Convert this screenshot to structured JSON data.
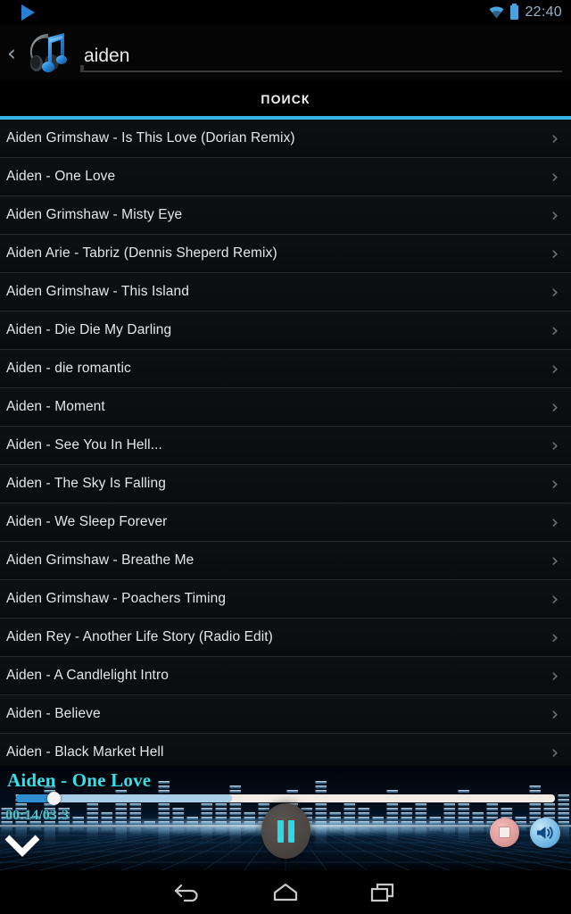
{
  "statusbar": {
    "notification_icon": "play-triangle-icon",
    "wifi_icon": "wifi-icon",
    "battery_icon": "battery-icon",
    "clock": "22:40",
    "clock_color": "#93b4c9",
    "accent_blue": "#2a7fd4"
  },
  "header": {
    "back_caret": "‹",
    "app_icon": "music-note-headphone-icon",
    "search_value": "aiden",
    "search_placeholder": "aiden"
  },
  "tab": {
    "label": "ПОИСК",
    "underline_color": "#33b5e5"
  },
  "list": {
    "chevron_glyph": "›",
    "items": [
      {
        "title": "Aiden Grimshaw - Is This Love (Dorian Remix)"
      },
      {
        "title": "Aiden - One Love"
      },
      {
        "title": "Aiden Grimshaw - Misty Eye"
      },
      {
        "title": "Aiden Arie - Tabriz (Dennis Sheperd Remix)"
      },
      {
        "title": "Aiden Grimshaw - This Island"
      },
      {
        "title": "Aiden - Die Die My Darling"
      },
      {
        "title": "Aiden - die romantic"
      },
      {
        "title": "Aiden - Moment"
      },
      {
        "title": "Aiden - See You In Hell..."
      },
      {
        "title": "Aiden - The Sky Is Falling"
      },
      {
        "title": "Aiden - We Sleep Forever"
      },
      {
        "title": "Aiden Grimshaw - Breathe Me"
      },
      {
        "title": "Aiden Grimshaw - Poachers Timing"
      },
      {
        "title": "Aiden Rey - Another Life Story (Radio Edit)"
      },
      {
        "title": "Aiden - A Candlelight Intro"
      },
      {
        "title": "Aiden - Believe"
      },
      {
        "title": "Aiden - Black Market Hell"
      }
    ]
  },
  "player": {
    "track_title": "Aiden - One Love",
    "title_color": "#35e0e8",
    "time_elapsed": "00:14",
    "time_total": "03:3",
    "time_display": "00:14/03:3",
    "progress_percent": 7,
    "buffered_percent": 40,
    "collapse_icon": "chevron-down-icon",
    "playpause_icon": "pause-icon",
    "playpause_state": "pause",
    "stop_icon": "stop-icon",
    "volume_icon": "volume-speaker-icon",
    "seek_fill_color": "#2f8fd0",
    "seek_buffer_color": "#a9cfe8",
    "seek_track_color": "#f2ece4"
  },
  "navbar": {
    "back_icon": "back-arrow-icon",
    "home_icon": "home-icon",
    "recents_icon": "recent-apps-icon"
  }
}
